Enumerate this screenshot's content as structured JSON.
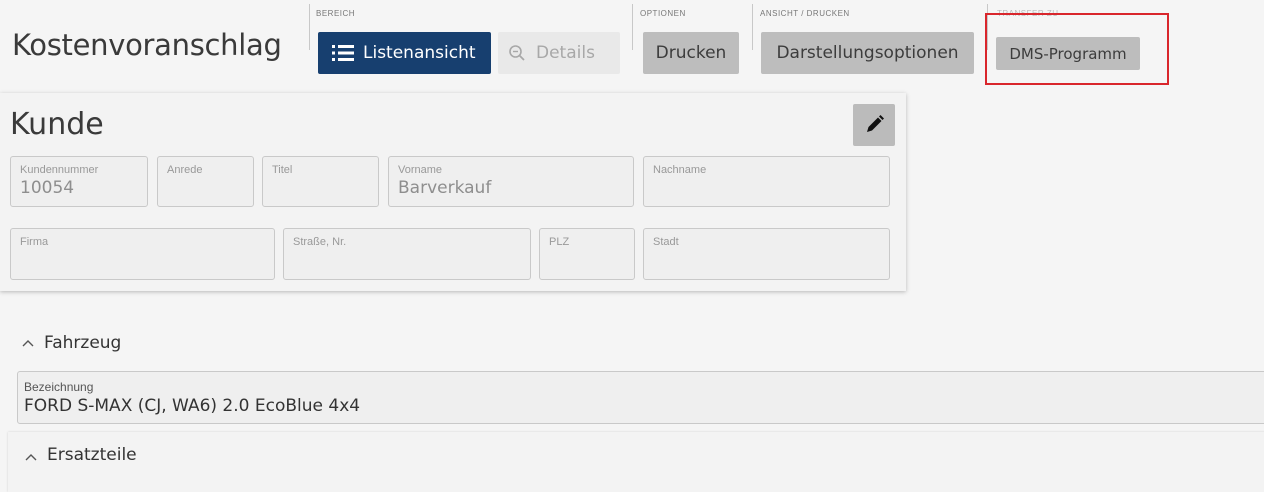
{
  "header": {
    "title": "Kostenvoranschlag",
    "groups": {
      "bereich": {
        "label": "BEREICH",
        "list_view": "Listenansicht",
        "details": "Details"
      },
      "optionen": {
        "label": "OPTIONEN",
        "print": "Drucken"
      },
      "ansicht": {
        "label": "ANSICHT / DRUCKEN",
        "display_options": "Darstellungsoptionen"
      },
      "transfer": {
        "label": "TRANSFER ZU",
        "dms": "DMS-Programm"
      }
    }
  },
  "customer": {
    "title": "Kunde",
    "fields": {
      "kundennummer": {
        "label": "Kundennummer",
        "value": "10054"
      },
      "anrede": {
        "label": "Anrede",
        "value": ""
      },
      "titel": {
        "label": "Titel",
        "value": ""
      },
      "vorname": {
        "label": "Vorname",
        "value": "Barverkauf"
      },
      "nachname": {
        "label": "Nachname",
        "value": ""
      },
      "firma": {
        "label": "Firma",
        "value": ""
      },
      "strasse": {
        "label": "Straße, Nr.",
        "value": ""
      },
      "plz": {
        "label": "PLZ",
        "value": ""
      },
      "stadt": {
        "label": "Stadt",
        "value": ""
      }
    }
  },
  "vehicle": {
    "section_title": "Fahrzeug",
    "field_label": "Bezeichnung",
    "field_value": "FORD S-MAX (CJ, WA6) 2.0 EcoBlue 4x4"
  },
  "parts": {
    "section_title": "Ersatzteile"
  },
  "colors": {
    "primary": "#173f6f",
    "highlight": "#d9262c"
  }
}
